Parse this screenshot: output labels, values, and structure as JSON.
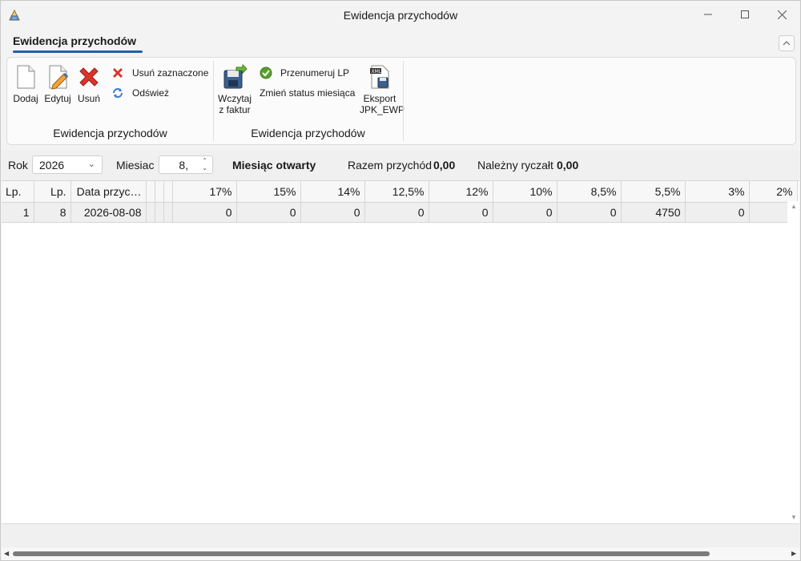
{
  "window": {
    "title": "Ewidencja przychodów",
    "controls": {
      "minimize": "—",
      "maximize": "☐",
      "close": "✕"
    }
  },
  "ribbon": {
    "tab_label": "Ewidencja przychodów",
    "collapse_glyph": "^",
    "groups": [
      {
        "label": "Ewidencja przychodów",
        "big_buttons": [
          {
            "label": "Dodaj",
            "icon": "new-document-icon"
          },
          {
            "label": "Edytuj",
            "icon": "edit-document-icon"
          },
          {
            "label": "Usuń",
            "icon": "delete-x-icon"
          }
        ],
        "small_buttons": [
          {
            "label": "Usuń zaznaczone",
            "icon": "delete-small-icon"
          },
          {
            "label": "Odśwież",
            "icon": "refresh-icon"
          }
        ]
      },
      {
        "label": "Ewidencja przychodów",
        "big_buttons": [
          {
            "label_line1": "Wczytaj",
            "label_line2": "z faktur",
            "icon": "load-save-icon"
          },
          {
            "label_line1": "Eksport",
            "label_line2": "JPK_EWP",
            "icon": "xml-export-icon"
          }
        ],
        "small_buttons": [
          {
            "label": "Przenumeruj LP",
            "icon": "check-circle-icon"
          },
          {
            "label": "Zmień status miesiąca",
            "icon": ""
          }
        ]
      }
    ]
  },
  "filter": {
    "year_label": "Rok",
    "year_value": "2026",
    "month_label": "Miesiac",
    "month_value": "8,",
    "status_text": "Miesiąc otwarty",
    "total_label": "Razem przychód",
    "total_value": "0,00",
    "tax_label": "Należny ryczałt",
    "tax_value": "0,00"
  },
  "grid": {
    "columns": [
      "Lp.",
      "Lp.",
      "Data przyc…",
      "",
      "",
      "",
      "17%",
      "15%",
      "14%",
      "12,5%",
      "12%",
      "10%",
      "8,5%",
      "5,5%",
      "3%",
      "2%"
    ],
    "rows": [
      [
        "1",
        "8",
        "2026-08-08",
        "",
        "",
        "",
        "0",
        "0",
        "0",
        "0",
        "0",
        "0",
        "0",
        "4750",
        "0",
        ""
      ]
    ]
  },
  "colors": {
    "accent": "#1f5fae",
    "delete_red": "#d9342b",
    "ok_green": "#5aa02c"
  }
}
